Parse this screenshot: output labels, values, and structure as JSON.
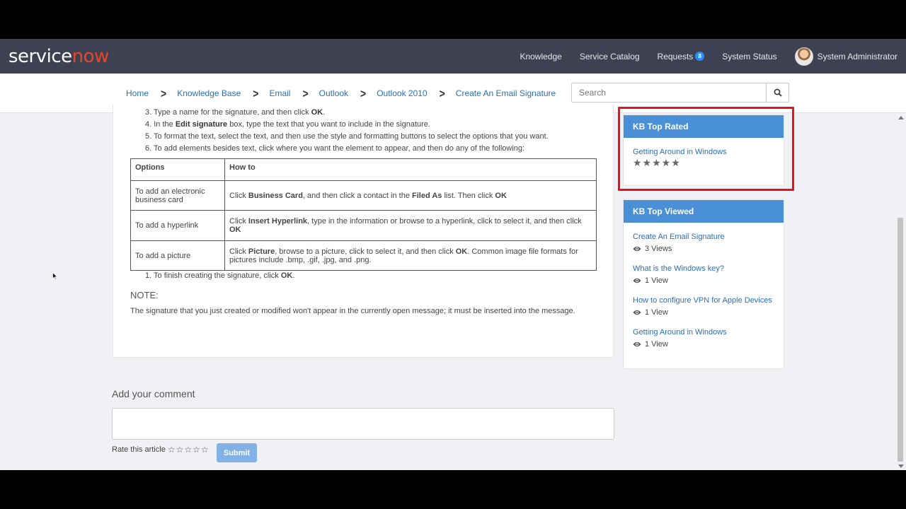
{
  "header": {
    "logo": {
      "service": "service",
      "now": "now"
    },
    "nav": [
      {
        "label": "Knowledge"
      },
      {
        "label": "Service Catalog"
      },
      {
        "label": "Requests",
        "badge": "8"
      },
      {
        "label": "System Status"
      }
    ],
    "user": "System Administrator"
  },
  "breadcrumb": [
    "Home",
    "Knowledge Base",
    "Email",
    "Outlook",
    "Outlook 2010",
    "Create An Email Signature"
  ],
  "search": {
    "placeholder": "Search"
  },
  "article": {
    "steps": [
      {
        "n": "3.",
        "pre": "Type a name for the signature, and then click ",
        "bold": "OK",
        "post": "."
      },
      {
        "n": "4.",
        "pre": "In the ",
        "bold": "Edit signature",
        "post": " box, type the text that you want to include in the signature."
      },
      {
        "n": "5.",
        "text": "To format the text, select the text, and then use the style and formatting buttons to select the options that you want."
      },
      {
        "n": "6.",
        "text": "To add elements besides text, click where you want the element to appear, and then do any of the following:"
      }
    ],
    "table": {
      "headers": [
        "Options",
        "How to"
      ],
      "rows": [
        {
          "option": "To add an electronic business card",
          "how": [
            {
              "t": "Click "
            },
            {
              "b": "Business Card"
            },
            {
              "t": ", and then click a contact in the "
            },
            {
              "b": "Filed As"
            },
            {
              "t": " list. Then click "
            },
            {
              "b": "OK"
            }
          ]
        },
        {
          "option": "To add a hyperlink",
          "how": [
            {
              "t": "Click "
            },
            {
              "b": "Insert Hyperlink"
            },
            {
              "t": ", type in the information or browse to a hyperlink, click to select it, and then click "
            },
            {
              "b": "OK"
            }
          ]
        },
        {
          "option": "To add a picture",
          "how": [
            {
              "t": "Click "
            },
            {
              "b": "Picture"
            },
            {
              "t": ", browse to a picture, click to select it, and then click "
            },
            {
              "b": "OK"
            },
            {
              "t": ". Common image file formats for pictures include .bmp, .gif, .jpg, and .png."
            }
          ]
        }
      ]
    },
    "final_step": {
      "n": "1.",
      "pre": "To finish creating the signature, click ",
      "bold": "OK",
      "post": "."
    },
    "note_heading": "NOTE:",
    "note_text": "The signature that you just created or modified won't appear in the currently open message; it must be inserted into the message."
  },
  "comment": {
    "heading": "Add your comment",
    "rate_label": "Rate this article",
    "rate_stars": "☆☆☆☆☆",
    "submit": "Submit"
  },
  "widgets": {
    "top_rated": {
      "title": "KB Top Rated",
      "items": [
        {
          "title": "Getting Around in Windows",
          "rating": "★★★★★"
        }
      ]
    },
    "top_viewed": {
      "title": "KB Top Viewed",
      "items": [
        {
          "title": "Create An Email Signature",
          "views": "3 Views"
        },
        {
          "title": "What is the Windows key?",
          "views": "1 View"
        },
        {
          "title": "How to configure VPN for Apple Devices",
          "views": "1 View"
        },
        {
          "title": "Getting Around in Windows",
          "views": "1 View"
        }
      ]
    }
  },
  "colors": {
    "header_bg": "#3e4152",
    "link": "#2a6fb6",
    "widget_header": "#4a90d6",
    "badge": "#278efc",
    "highlight": "#e3141b",
    "logo_accent": "#e4462a"
  }
}
